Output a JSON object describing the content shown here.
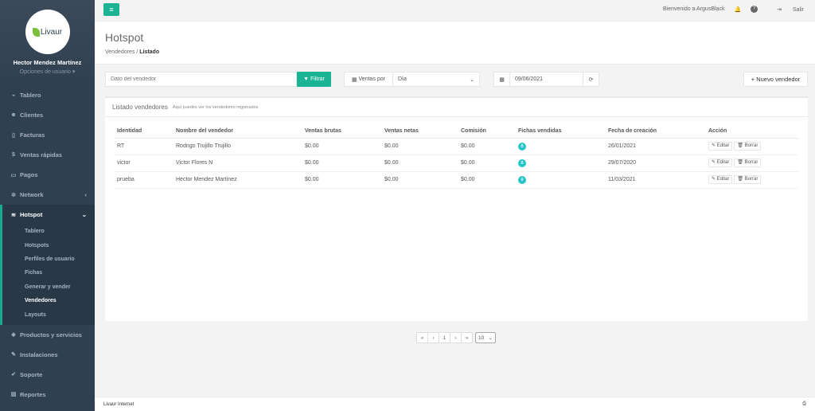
{
  "app": {
    "logo_text": "Livaur"
  },
  "profile": {
    "name": "Hector Mendez Martínez",
    "options": "Opciones de usuario"
  },
  "sidebar": {
    "items": [
      {
        "label": "Tablero",
        "icon": "dashboard-icon",
        "glyph": "◒"
      },
      {
        "label": "Clientes",
        "icon": "users-icon",
        "glyph": "👥"
      },
      {
        "label": "Facturas",
        "icon": "file-icon",
        "glyph": "▯"
      },
      {
        "label": "Ventas rápidas",
        "icon": "dollar-icon",
        "glyph": "$"
      },
      {
        "label": "Pagos",
        "icon": "money-icon",
        "glyph": "▭"
      },
      {
        "label": "Network",
        "icon": "network-icon",
        "glyph": "✲"
      }
    ],
    "hotspot": {
      "label": "Hotspot",
      "icon": "wifi-icon",
      "glyph": "≋"
    },
    "hotspot_sub": [
      "Tablero",
      "Hotspots",
      "Perfiles de usuario",
      "Fichas",
      "Generar y vender",
      "Vendedores",
      "Layouts"
    ],
    "items_bottom": [
      {
        "label": "Productos y servicios",
        "icon": "tag-icon",
        "glyph": "◈"
      },
      {
        "label": "Instalaciones",
        "icon": "plug-icon",
        "glyph": "✎"
      },
      {
        "label": "Soporte",
        "icon": "wrench-icon",
        "glyph": "✔"
      },
      {
        "label": "Reportes",
        "icon": "book-icon",
        "glyph": "▤"
      }
    ]
  },
  "topbar": {
    "welcome": "Bienvenido a ArgusBlack",
    "logout": "Salir"
  },
  "heading": {
    "title": "Hotspot",
    "crumb_parent": "Vendedores",
    "crumb_current": "Listado"
  },
  "filters": {
    "search_placeholder": "Dato del vendedor",
    "filter_label": "Filtrar",
    "ventas_por_label": "Ventas por",
    "ventas_por_value": "Día",
    "date_value": "09/06/2021",
    "new_button": "Nuevo vendedor"
  },
  "card": {
    "title": "Listado vendedores",
    "subtitle": "Aquí puedes ver los vendedores registrados"
  },
  "table": {
    "headers": [
      "Identidad",
      "Nombre del vendedor",
      "Ventas brutas",
      "Ventas netas",
      "Comisión",
      "Fichas vendidas",
      "Fecha de creación",
      "Acción"
    ],
    "rows": [
      {
        "id": "RT",
        "name": "Rodrigo Trujillo Trujillo",
        "brutas": "$0.00",
        "netas": "$0.00",
        "comision": "$0.00",
        "fichas": "0",
        "fecha": "26/01/2021"
      },
      {
        "id": "victor",
        "name": "Victor Flores N",
        "brutas": "$0.00",
        "netas": "$0.00",
        "comision": "$0.00",
        "fichas": "0",
        "fecha": "29/07/2020"
      },
      {
        "id": "prueba",
        "name": "Hector Mendez Martínez",
        "brutas": "$0.00",
        "netas": "$0.00",
        "comision": "$0.00",
        "fichas": "0",
        "fecha": "11/03/2021"
      }
    ],
    "edit_label": "Editar",
    "delete_label": "Borrar"
  },
  "pagination": {
    "first": "«",
    "prev": "‹",
    "page": "1",
    "next": "›",
    "last": "»",
    "page_size": "10"
  },
  "footer": {
    "text": "Livaur Internet"
  },
  "colors": {
    "primary": "#1ab394",
    "sidebar": "#2f4050",
    "badge": "#23c6c8"
  }
}
